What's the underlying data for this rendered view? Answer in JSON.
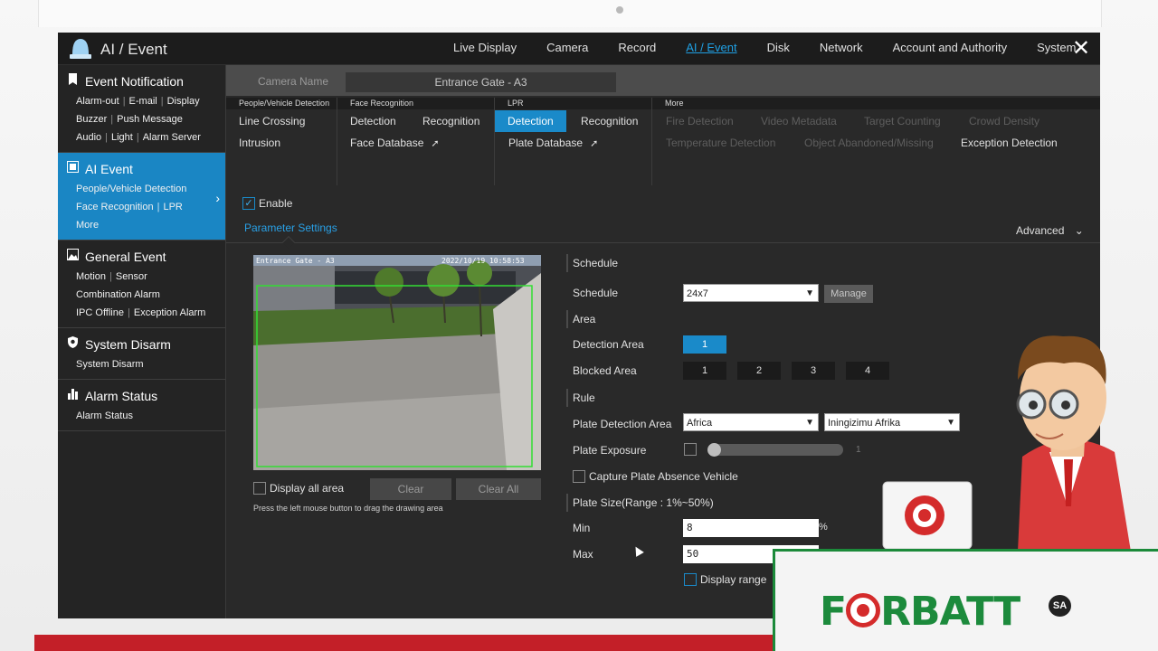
{
  "app": {
    "title": "AI / Event"
  },
  "nav": [
    "Live Display",
    "Camera",
    "Record",
    "AI / Event",
    "Disk",
    "Network",
    "Account and Authority",
    "System"
  ],
  "nav_active": "AI / Event",
  "sidebar": {
    "event_notification": {
      "title": "Event Notification",
      "links": [
        [
          "Alarm-out",
          "E-mail",
          "Display"
        ],
        [
          "Buzzer",
          "Push Message"
        ],
        [
          "Audio",
          "Light",
          "Alarm Server"
        ]
      ]
    },
    "ai_event": {
      "title": "AI Event",
      "links": [
        [
          "People/Vehicle Detection"
        ],
        [
          "Face Recognition",
          "LPR"
        ],
        [
          "More"
        ]
      ]
    },
    "general_event": {
      "title": "General Event",
      "links": [
        [
          "Motion",
          "Sensor"
        ],
        [
          "Combination Alarm"
        ],
        [
          "IPC Offline",
          "Exception Alarm"
        ]
      ]
    },
    "system_disarm": {
      "title": "System Disarm",
      "links": [
        [
          "System Disarm"
        ]
      ]
    },
    "alarm_status": {
      "title": "Alarm Status",
      "links": [
        [
          "Alarm Status"
        ]
      ]
    }
  },
  "camera": {
    "label": "Camera Name",
    "value": "Entrance Gate - A3"
  },
  "tab_groups": {
    "people_vehicle": {
      "head": "People/Vehicle Detection",
      "tabs": [
        "Line Crossing",
        "Intrusion"
      ]
    },
    "face": {
      "head": "Face Recognition",
      "tabs": [
        "Detection",
        "Recognition",
        "Face Database"
      ]
    },
    "lpr": {
      "head": "LPR",
      "tabs": [
        "Detection",
        "Recognition",
        "Plate Database"
      ]
    },
    "more": {
      "head": "More",
      "tabs": [
        "Fire Detection",
        "Video Metadata",
        "Target Counting",
        "Crowd Density",
        "Temperature Detection",
        "Object Abandoned/Missing",
        "Exception Detection"
      ]
    }
  },
  "enable": {
    "label": "Enable",
    "checked": true
  },
  "parameter_tab": "Parameter Settings",
  "advanced": "Advanced",
  "preview": {
    "camera_name": "Entrance Gate - A3",
    "timestamp": "2022/10/19 10:58:53"
  },
  "display_all_area": "Display all area",
  "clear": "Clear",
  "clear_all": "Clear All",
  "hint": "Press the left mouse button to drag the drawing area",
  "form": {
    "schedule_section": "Schedule",
    "schedule_label": "Schedule",
    "schedule_value": "24x7",
    "manage": "Manage",
    "area_section": "Area",
    "detection_area_label": "Detection Area",
    "detection_areas": [
      "1"
    ],
    "blocked_area_label": "Blocked Area",
    "blocked_areas": [
      "1",
      "2",
      "3",
      "4"
    ],
    "rule_section": "Rule",
    "plate_detection_area_label": "Plate Detection Area",
    "plate_region": "Africa",
    "plate_country": "Iningizimu Afrika",
    "plate_exposure_label": "Plate Exposure",
    "plate_exposure_checked": false,
    "plate_exposure_value": "1",
    "capture_absence": "Capture Plate Absence Vehicle",
    "plate_size_label": "Plate Size(Range : 1%~50%)",
    "min_label": "Min",
    "min_value": "8",
    "max_label": "Max",
    "max_value": "50",
    "percent": "%",
    "display_range": "Display range"
  },
  "brand": {
    "name_left": "F",
    "name_right": "RBATT",
    "badge": "SA"
  },
  "colors": {
    "accent": "#1a8ac9",
    "brand_green": "#1c8a3c",
    "brand_red": "#d42b2b",
    "detection_box": "#33dd33"
  }
}
